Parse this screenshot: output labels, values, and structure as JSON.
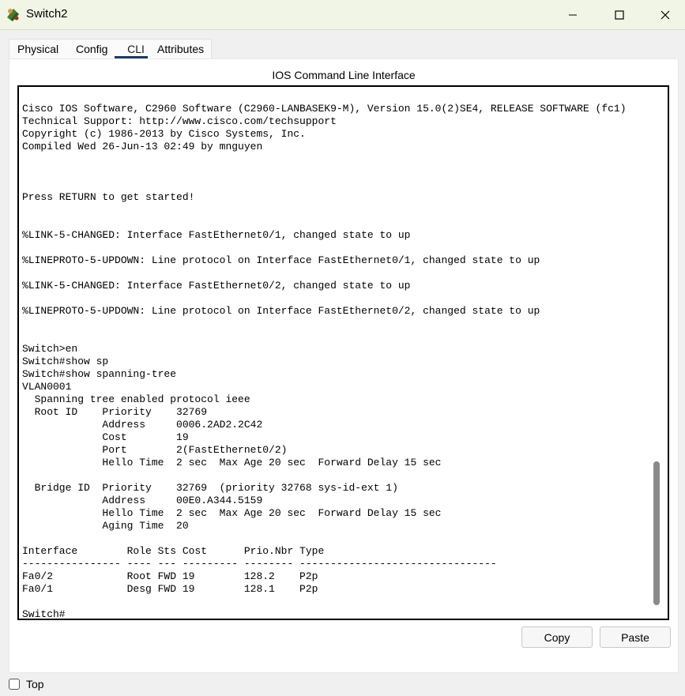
{
  "window": {
    "title": "Switch2",
    "icons": {
      "app": "network-switch-icon",
      "minimize": "minimize-icon",
      "maximize": "maximize-icon",
      "close": "close-icon"
    }
  },
  "tabs": [
    {
      "label": "Physical",
      "active": false
    },
    {
      "label": "Config",
      "active": false
    },
    {
      "label": "CLI",
      "active": true
    },
    {
      "label": "Attributes",
      "active": false
    }
  ],
  "cli": {
    "header": "IOS Command Line Interface",
    "lines": [
      "",
      "",
      "Cisco IOS Software, C2960 Software (C2960-LANBASEK9-M), Version 15.0(2)SE4, RELEASE SOFTWARE (fc1)",
      "Technical Support: http://www.cisco.com/techsupport",
      "Copyright (c) 1986-2013 by Cisco Systems, Inc.",
      "Compiled Wed 26-Jun-13 02:49 by mnguyen",
      "",
      "",
      "",
      "Press RETURN to get started!",
      "",
      "",
      "%LINK-5-CHANGED: Interface FastEthernet0/1, changed state to up",
      "",
      "%LINEPROTO-5-UPDOWN: Line protocol on Interface FastEthernet0/1, changed state to up",
      "",
      "%LINK-5-CHANGED: Interface FastEthernet0/2, changed state to up",
      "",
      "%LINEPROTO-5-UPDOWN: Line protocol on Interface FastEthernet0/2, changed state to up",
      "",
      "",
      "Switch>en",
      "Switch#show sp",
      "Switch#show spanning-tree",
      "VLAN0001",
      "  Spanning tree enabled protocol ieee",
      "  Root ID    Priority    32769",
      "             Address     0006.2AD2.2C42",
      "             Cost        19",
      "             Port        2(FastEthernet0/2)",
      "             Hello Time  2 sec  Max Age 20 sec  Forward Delay 15 sec",
      "",
      "  Bridge ID  Priority    32769  (priority 32768 sys-id-ext 1)",
      "             Address     00E0.A344.5159",
      "             Hello Time  2 sec  Max Age 20 sec  Forward Delay 15 sec",
      "             Aging Time  20",
      "",
      "Interface        Role Sts Cost      Prio.Nbr Type",
      "---------------- ---- --- --------- -------- --------------------------------",
      "Fa0/2            Root FWD 19        128.2    P2p",
      "Fa0/1            Desg FWD 19        128.1    P2p",
      "",
      "Switch#"
    ]
  },
  "buttons": {
    "copy": "Copy",
    "paste": "Paste"
  },
  "footer": {
    "top_label": "Top",
    "top_checked": false
  }
}
